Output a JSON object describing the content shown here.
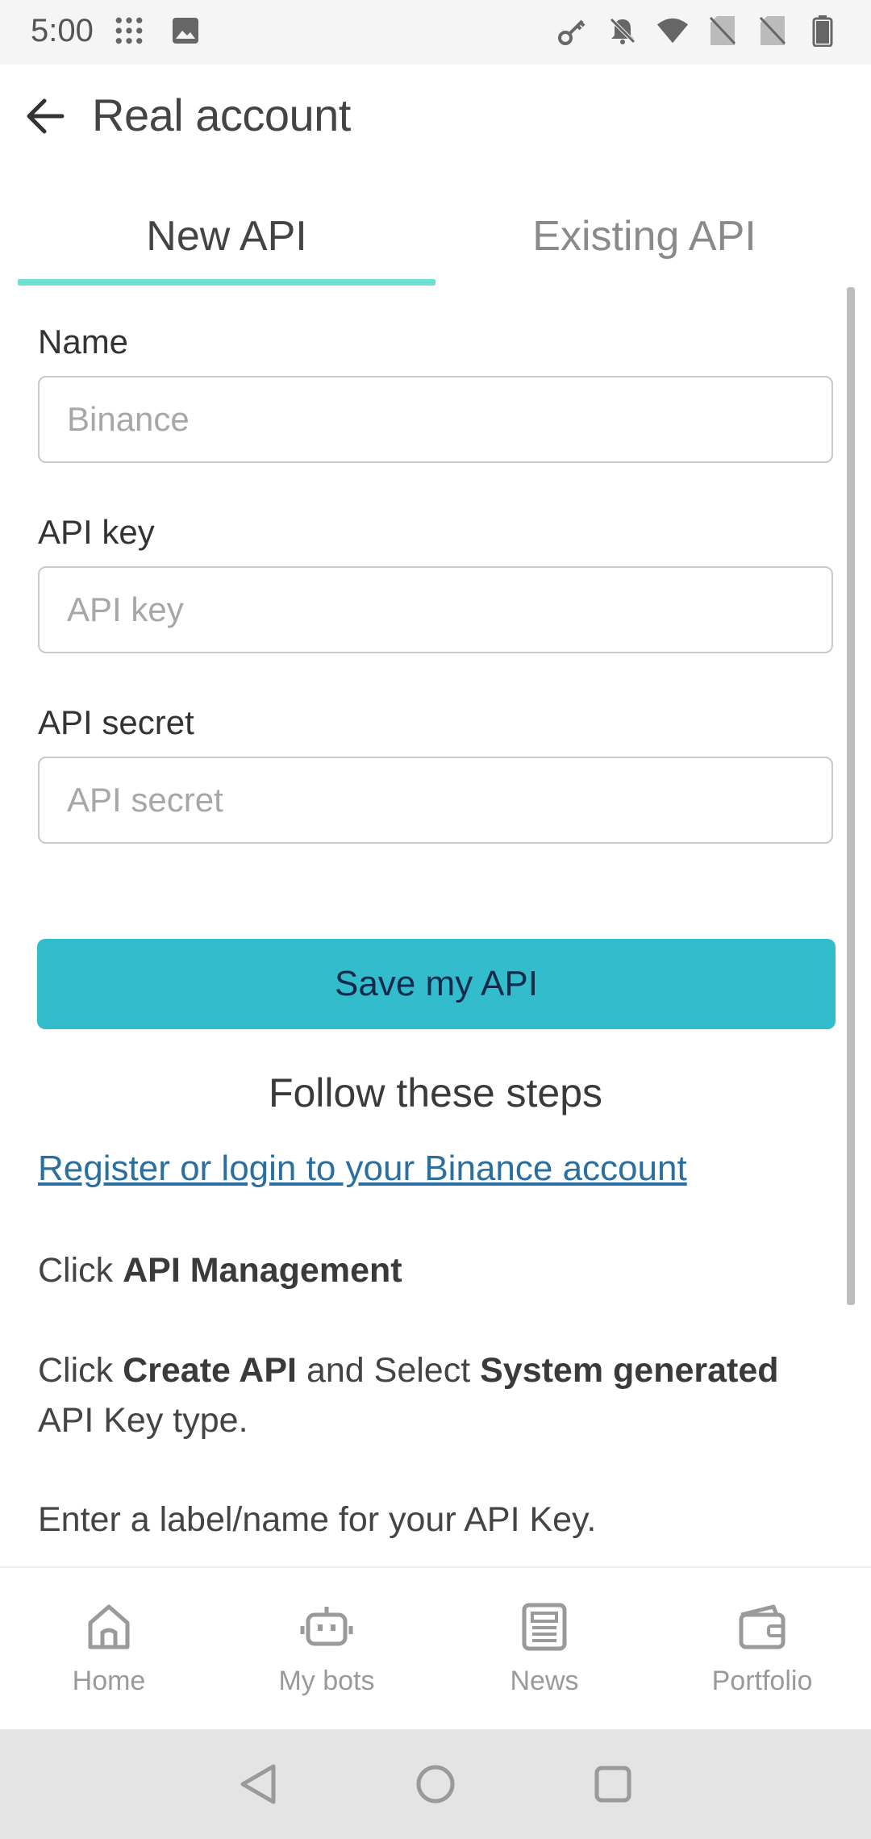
{
  "status_bar": {
    "time": "5:00",
    "left_icons": [
      "dots-grid-icon",
      "image-icon"
    ],
    "right_icons": [
      "key-icon",
      "bell-off-icon",
      "wifi-icon",
      "sim-off-icon",
      "sim-off-icon",
      "battery-icon"
    ]
  },
  "app_bar": {
    "title": "Real account",
    "back_icon": "arrow-left-icon"
  },
  "tabs": [
    {
      "label": "New API",
      "selected": true
    },
    {
      "label": "Existing API",
      "selected": false
    }
  ],
  "accent_color": "#6ee0cf",
  "form": {
    "name": {
      "label": "Name",
      "placeholder": "Binance",
      "value": ""
    },
    "api_key": {
      "label": "API key",
      "placeholder": "API key",
      "value": ""
    },
    "api_secret": {
      "label": "API secret",
      "placeholder": "API secret",
      "value": ""
    },
    "save_label": "Save my API",
    "save_color": "#33bccb"
  },
  "steps": {
    "title": "Follow these steps",
    "link": "Register or login to your Binance account",
    "step2": {
      "pre": "Click ",
      "bold": "API Management"
    },
    "step3": {
      "pre": "Click ",
      "bold1": "Create API",
      "mid": " and Select ",
      "bold2": "System generated",
      "post": " API Key type."
    },
    "step4": "Enter a label/name for your API Key."
  },
  "bottom_nav": [
    {
      "label": "Home",
      "icon": "home-icon"
    },
    {
      "label": "My bots",
      "icon": "robot-icon"
    },
    {
      "label": "News",
      "icon": "newspaper-icon"
    },
    {
      "label": "Portfolio",
      "icon": "wallet-icon"
    }
  ],
  "system_nav": [
    "back-triangle-icon",
    "home-circle-icon",
    "recents-square-icon"
  ]
}
